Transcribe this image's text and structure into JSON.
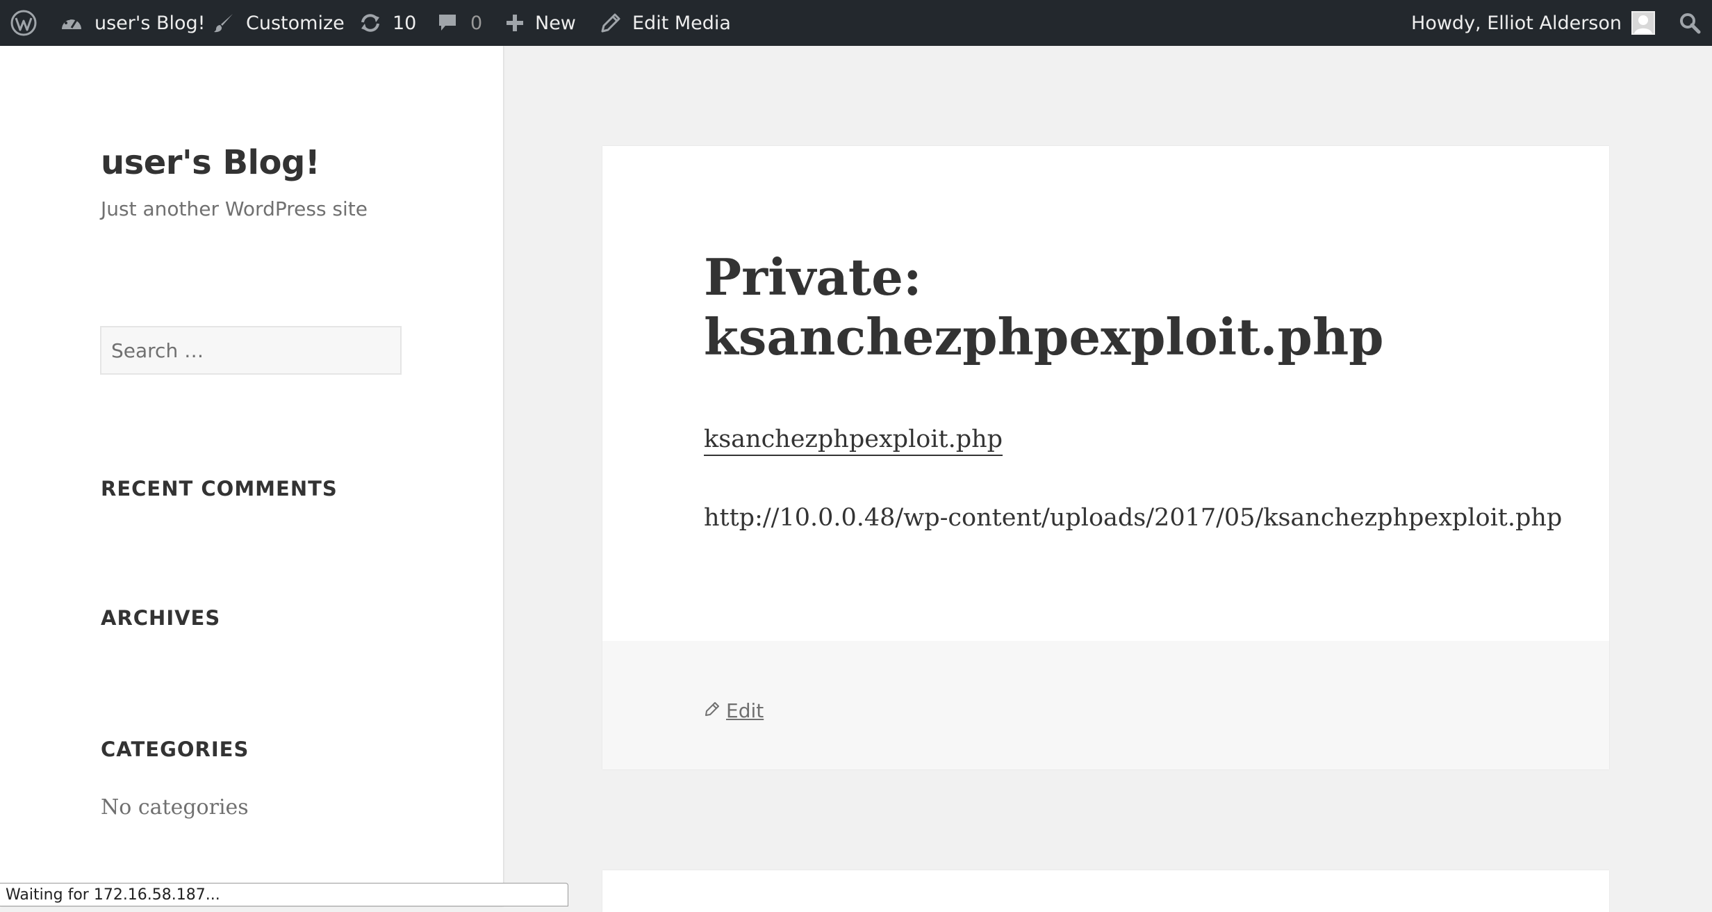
{
  "adminbar": {
    "site_name": "user's Blog!",
    "customize": "Customize",
    "updates_count": "10",
    "comments_count": "0",
    "new_label": "New",
    "edit_media": "Edit Media",
    "howdy": "Howdy, Elliot Alderson"
  },
  "sidebar": {
    "site_title": "user's Blog!",
    "site_description": "Just another WordPress site",
    "search_placeholder": "Search …",
    "widgets": {
      "recent_comments": "RECENT COMMENTS",
      "archives": "ARCHIVES",
      "categories": "CATEGORIES",
      "no_categories": "No categories"
    }
  },
  "post": {
    "title_prefix": "Private:",
    "title_name": "ksanchezphpexploit.php",
    "attachment_link": "ksanchezphpexploit.php",
    "attachment_url": "http://10.0.0.48/wp-content/uploads/2017/05/ksanchezphpexploit.php",
    "edit_label": "Edit"
  },
  "status_bar": {
    "text": "Waiting for 172.16.58.187..."
  },
  "colors": {
    "adminbar_bg": "#23282d",
    "page_bg": "#f1f1f1",
    "text": "#333333",
    "muted": "#707070"
  },
  "icons": [
    "wordpress-logo-icon",
    "dashboard-icon",
    "paintbrush-icon",
    "updates-icon",
    "comment-icon",
    "plus-icon",
    "pencil-icon",
    "avatar",
    "search-icon"
  ]
}
